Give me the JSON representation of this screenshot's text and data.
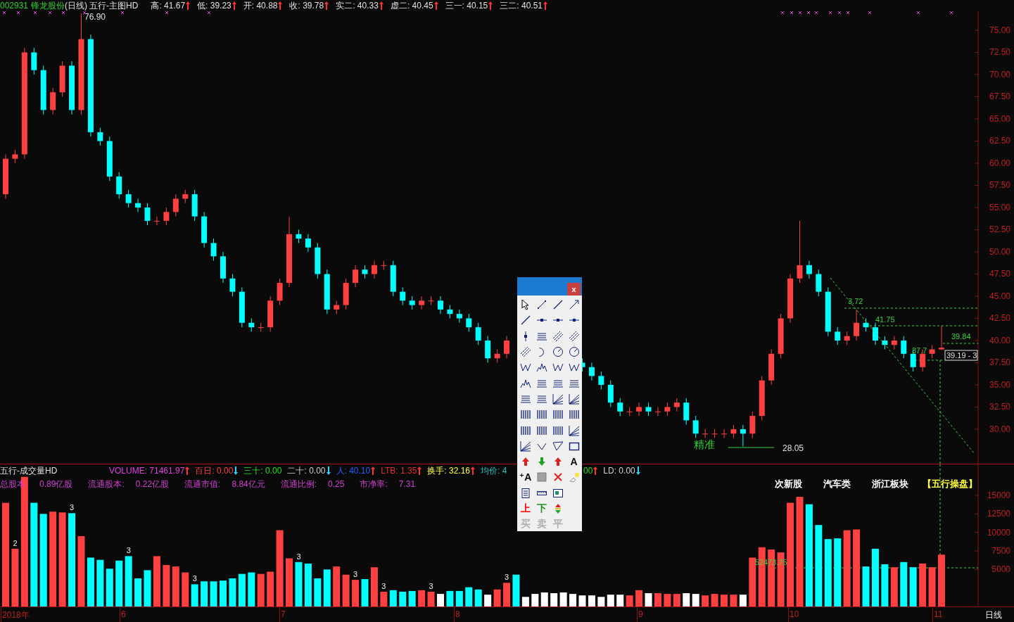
{
  "header": {
    "code": "002931",
    "name": "锋龙股份",
    "period": "(日线)",
    "indicator": "五行-主图HD",
    "quotes": [
      {
        "text": "高: 41.67",
        "arrow_up": true
      },
      {
        "text": "低: 39.23",
        "arrow_up": true
      },
      {
        "text": "开: 40.88",
        "arrow_up": true
      },
      {
        "text": "收: 39.78",
        "arrow_up": true
      },
      {
        "text": "实二: 40.33",
        "arrow_up": true
      },
      {
        "text": "虚二: 40.45",
        "arrow_up": true
      },
      {
        "text": "三一: 40.15",
        "arrow_up": true
      },
      {
        "text": "三二: 40.51",
        "arrow_up": true
      }
    ]
  },
  "price_chart": {
    "chart_data": {
      "type": "candlestick",
      "ylim": [
        26.11,
        77.14
      ],
      "yticks": [
        {
          "value": 30,
          "label": "30.00"
        },
        {
          "value": 32.5,
          "label": "32.50"
        },
        {
          "value": 35,
          "label": "35.00"
        },
        {
          "value": 37.5,
          "label": "37.50"
        },
        {
          "value": 40,
          "label": "40.00"
        },
        {
          "value": 42.5,
          "label": "42.50"
        },
        {
          "value": 45,
          "label": "45.00"
        },
        {
          "value": 47.5,
          "label": "47.50"
        },
        {
          "value": 50,
          "label": "50.00"
        },
        {
          "value": 52.5,
          "label": "52.50"
        },
        {
          "value": 55,
          "label": "55.00"
        },
        {
          "value": 57.5,
          "label": "57.50"
        },
        {
          "value": 60,
          "label": "60.00"
        },
        {
          "value": 62.5,
          "label": "62.50"
        },
        {
          "value": 65,
          "label": "65.00"
        },
        {
          "value": 67.5,
          "label": "67.50"
        },
        {
          "value": 70,
          "label": "70.00"
        },
        {
          "value": 72.5,
          "label": "72.50"
        },
        {
          "value": 75,
          "label": "75.00"
        }
      ],
      "categories": [
        null,
        null,
        null,
        null,
        null,
        null,
        null,
        null,
        null,
        null,
        null,
        null,
        null,
        null,
        null,
        null,
        null,
        null,
        null,
        null,
        null,
        null,
        null,
        null,
        null,
        null,
        null,
        null,
        null,
        null,
        null,
        null,
        null,
        null,
        null,
        null,
        null,
        null,
        null,
        null,
        null,
        null,
        null,
        null,
        null,
        null,
        null,
        null,
        null,
        null,
        null,
        null,
        null,
        null,
        null,
        null,
        null,
        null,
        null,
        null,
        null,
        null,
        null,
        null,
        null,
        null,
        null,
        null,
        null,
        null,
        null,
        null,
        null,
        null,
        null,
        null,
        null,
        null,
        null,
        null,
        null,
        null,
        null,
        null,
        null,
        null,
        null,
        null,
        null,
        null,
        null,
        null,
        null,
        null,
        null,
        null,
        null,
        null,
        null,
        null
      ],
      "ohlc": [
        [
          56.5,
          61,
          56,
          60.5
        ],
        [
          60.5,
          61.5,
          60,
          61
        ],
        [
          61,
          73,
          60.5,
          72.5
        ],
        [
          72.5,
          73,
          70,
          70.5
        ],
        [
          70.5,
          71,
          65.5,
          66
        ],
        [
          66,
          68.5,
          65.5,
          68
        ],
        [
          68,
          71.5,
          67.5,
          71
        ],
        [
          71,
          71.5,
          65.5,
          66
        ],
        [
          66,
          76.9,
          65.5,
          74
        ],
        [
          74,
          74.5,
          63,
          63.5
        ],
        [
          63.5,
          64,
          62,
          62.5
        ],
        [
          62.5,
          63,
          58,
          58.5
        ],
        [
          58.5,
          59,
          56,
          56.5
        ],
        [
          56.5,
          57,
          55,
          55.5
        ],
        [
          55.5,
          56,
          54.5,
          55
        ],
        [
          55,
          55.5,
          53,
          53.5
        ],
        [
          53.5,
          54,
          53,
          53.5
        ],
        [
          53.5,
          55,
          53,
          54.5
        ],
        [
          54.5,
          56.5,
          54,
          56
        ],
        [
          56,
          57,
          55.5,
          56.5
        ],
        [
          56.5,
          57,
          53.5,
          54
        ],
        [
          54,
          54.5,
          50.5,
          51
        ],
        [
          51,
          51.5,
          49,
          49.5
        ],
        [
          49.5,
          50,
          46.5,
          47
        ],
        [
          47,
          47.5,
          45,
          45.5
        ],
        [
          45.5,
          46,
          41.5,
          42
        ],
        [
          42,
          42.5,
          41,
          41.5
        ],
        [
          41.5,
          42,
          41,
          41.5
        ],
        [
          41.5,
          45,
          41,
          44.5
        ],
        [
          44.5,
          47,
          44,
          46.5
        ],
        [
          46.5,
          54,
          46,
          52
        ],
        [
          52,
          52.5,
          51,
          51.5
        ],
        [
          51.5,
          52,
          50,
          50.5
        ],
        [
          50.5,
          51,
          47,
          47.5
        ],
        [
          47.5,
          48,
          43,
          43.5
        ],
        [
          43.5,
          44.5,
          43,
          44
        ],
        [
          44,
          47,
          43.5,
          46.5
        ],
        [
          46.5,
          48.5,
          46,
          48
        ],
        [
          48,
          48.5,
          47,
          47.5
        ],
        [
          47.5,
          49,
          47,
          48.5
        ],
        [
          48.5,
          49,
          48,
          48.5
        ],
        [
          48.5,
          49,
          45,
          45.5
        ],
        [
          45.5,
          46,
          44,
          44.5
        ],
        [
          44.5,
          45,
          43.5,
          44
        ],
        [
          44,
          45,
          43.5,
          44.5
        ],
        [
          44.5,
          45,
          44,
          44.5
        ],
        [
          44.5,
          45,
          43,
          43.5
        ],
        [
          43.5,
          44,
          42.5,
          43
        ],
        [
          43,
          43.5,
          42,
          42.5
        ],
        [
          42.5,
          43,
          41,
          41.5
        ],
        [
          41.5,
          42,
          39.5,
          40
        ],
        [
          40,
          40.5,
          37.5,
          38
        ],
        [
          38,
          39,
          37.5,
          38.5
        ],
        [
          38.5,
          40.5,
          38,
          40
        ],
        null,
        null,
        null,
        null,
        null,
        null,
        null,
        [
          37.5,
          38,
          36.5,
          37
        ],
        [
          37,
          37.5,
          35.5,
          36
        ],
        [
          36,
          36.5,
          34.5,
          35
        ],
        [
          35,
          35.5,
          32.5,
          33
        ],
        [
          33,
          33.5,
          31.5,
          32
        ],
        [
          32,
          32.5,
          31.5,
          32
        ],
        [
          32,
          33,
          31.5,
          32.5
        ],
        [
          32.5,
          33,
          31.5,
          32
        ],
        [
          32,
          32.5,
          31.5,
          32
        ],
        [
          32,
          33,
          31.5,
          32.5
        ],
        [
          32.5,
          33.5,
          32,
          33
        ],
        [
          33,
          33.5,
          30.5,
          31
        ],
        [
          31,
          31.5,
          29,
          29.5
        ],
        [
          29.5,
          30,
          29,
          29.5
        ],
        [
          29.5,
          30,
          29,
          29.5
        ],
        [
          29.5,
          30,
          29,
          29.5
        ],
        [
          29.5,
          30.5,
          29,
          30
        ],
        [
          30,
          30.5,
          28.05,
          29.5
        ],
        [
          29.5,
          32,
          29,
          31.5
        ],
        [
          31.5,
          36,
          31,
          35.5
        ],
        [
          35.5,
          39,
          35,
          38.5
        ],
        [
          38.5,
          43,
          38,
          42.5
        ],
        [
          42.5,
          47.5,
          42,
          47
        ],
        [
          47,
          53.5,
          46.5,
          48.5
        ],
        [
          48.5,
          49,
          47,
          47.5
        ],
        [
          47.5,
          48,
          45,
          45.5
        ],
        [
          45.5,
          46,
          40.5,
          41
        ],
        [
          41,
          41.5,
          39.5,
          40
        ],
        [
          40,
          41,
          39.5,
          40.5
        ],
        [
          40.5,
          43.5,
          40,
          42
        ],
        [
          42,
          42.5,
          41,
          41.5
        ],
        [
          41.5,
          42,
          39.5,
          40
        ],
        [
          40,
          40.5,
          39,
          39.5
        ],
        [
          39.5,
          40.5,
          39,
          40
        ],
        [
          40,
          40.5,
          38,
          38.5
        ],
        [
          38.5,
          39,
          36.5,
          37
        ],
        [
          37,
          39,
          36.5,
          38.5
        ],
        [
          38.5,
          39.5,
          38,
          39
        ],
        [
          39,
          41.67,
          39,
          39.19
        ]
      ],
      "annotations": [
        "76.90",
        "28.05",
        "精准",
        "3.72",
        "41.75",
        "39.84",
        "37.7",
        "39.19 - 3"
      ]
    }
  },
  "volume_header": {
    "title": "五行-成交量HD",
    "items": [
      {
        "text": "VOLUME: 71461.97",
        "color": "#e040e0",
        "arrow_up": true,
        "arrow_down": false
      },
      {
        "text": "百日: 0.00",
        "color": "#ff4040",
        "arrow_up": false,
        "arrow_down": true
      },
      {
        "text": "三十: 0.00",
        "color": "#20e020",
        "arrow_up": false,
        "arrow_down": false
      },
      {
        "text": "二十: 0.00",
        "color": "#d0d0d0",
        "arrow_up": false,
        "arrow_down": true
      },
      {
        "text": "人: 40.10",
        "color": "#2060ff",
        "arrow_up": true,
        "arrow_down": false
      },
      {
        "text": "LTB: 1.35",
        "color": "#e03030",
        "arrow_up": true,
        "arrow_down": false
      },
      {
        "text": "换手: 32.16",
        "color": "#ffff40",
        "arrow_up": true,
        "arrow_down": false
      },
      {
        "text": "均价: 4",
        "color": "#20c0c0",
        "arrow_up": false,
        "arrow_down": false
      }
    ],
    "items_after_palette": [
      {
        "text": "00",
        "color": "#20e020",
        "arrow_up": true,
        "arrow_down": false
      },
      {
        "text": "LD: 0.00",
        "color": "#d0d0d0",
        "arrow_up": false,
        "arrow_down": true
      }
    ],
    "stats": [
      {
        "label": "总股本",
        "value": "0.89亿股"
      },
      {
        "label": "流通股本:",
        "value": "0.22亿股"
      },
      {
        "label": "流通市值:",
        "value": "8.84亿元"
      },
      {
        "label": "流通比例:",
        "value": "0.25"
      },
      {
        "label": "市净率:",
        "value": "7.31"
      }
    ],
    "tags": [
      {
        "text": "次新股",
        "color": "#ffffff"
      },
      {
        "text": "汽车类",
        "color": "#ffffff"
      },
      {
        "text": "浙江板块",
        "color": "#ffffff"
      },
      {
        "text": "【五行操盘】",
        "color": "#ffff40"
      }
    ]
  },
  "volume_chart": {
    "chart_data": {
      "type": "bar",
      "ylim": [
        0,
        19183
      ],
      "yticks": [
        5000,
        7500,
        10000,
        12500,
        15000
      ],
      "categories": [
        null,
        null,
        null,
        null,
        null,
        null,
        null,
        null,
        null,
        null,
        null,
        null,
        null,
        null,
        null,
        null,
        null,
        null,
        null,
        null,
        null,
        null,
        null,
        null,
        null,
        null,
        null,
        null,
        null,
        null,
        null,
        null,
        null,
        null,
        null,
        null,
        null,
        null,
        null,
        null,
        null,
        null,
        null,
        null,
        null,
        null,
        null,
        null,
        null,
        null,
        null,
        null,
        null,
        null,
        null,
        null,
        null,
        null,
        null,
        null,
        null,
        null,
        null,
        null,
        null,
        null,
        null,
        null,
        null,
        null,
        null,
        null,
        null,
        null,
        null,
        null,
        null,
        null,
        null,
        null,
        null,
        null,
        null,
        null,
        null,
        null,
        null,
        null,
        null,
        null,
        null,
        null,
        null,
        null,
        null,
        null,
        null,
        null,
        null,
        null
      ],
      "values": [
        14000,
        7800,
        17500,
        14000,
        12500,
        12800,
        12700,
        12600,
        9500,
        6600,
        6300,
        5100,
        6200,
        6800,
        3800,
        4900,
        6800,
        5600,
        5400,
        4600,
        3000,
        3400,
        3400,
        3500,
        3800,
        4400,
        4600,
        4400,
        4700,
        10300,
        6500,
        6000,
        5800,
        3800,
        5000,
        5400,
        4300,
        3600,
        3700,
        5300,
        2000,
        2200,
        2000,
        2100,
        2200,
        2000,
        1700,
        2100,
        2100,
        2600,
        2300,
        1600,
        2300,
        3200,
        4300,
        1300,
        1700,
        1900,
        1800,
        1900,
        1700,
        1500,
        1500,
        1300,
        1600,
        1600,
        1500,
        2200,
        1800,
        1800,
        1700,
        1700,
        1800,
        1700,
        1500,
        1700,
        1600,
        1600,
        1600,
        6600,
        8000,
        7700,
        7300,
        14000,
        14800,
        13800,
        11000,
        9100,
        9200,
        10300,
        10400,
        5400,
        7800,
        5700,
        5300,
        6000,
        5300,
        5800,
        5300,
        7000
      ],
      "annotations": [
        "2",
        "3",
        "3",
        "3",
        "3",
        "3",
        "3",
        "3",
        "3",
        "52473.75"
      ]
    }
  },
  "date_axis": {
    "labels": [
      "2018年",
      "6",
      "7",
      "8",
      "9",
      "10",
      "11"
    ],
    "period": "日线"
  },
  "draw_palette": {
    "tools": [
      {
        "kind": "cursor"
      },
      {
        "kind": "segment"
      },
      {
        "kind": "line"
      },
      {
        "kind": "arrow"
      },
      {
        "kind": "line"
      },
      {
        "kind": "dot-segment"
      },
      {
        "kind": "dot-segment"
      },
      {
        "kind": "dot-segment"
      },
      {
        "kind": "v-tick"
      },
      {
        "kind": "lines"
      },
      {
        "kind": "parallel"
      },
      {
        "kind": "parallel"
      },
      {
        "kind": "parallel"
      },
      {
        "kind": "arc"
      },
      {
        "kind": "circle"
      },
      {
        "kind": "circle"
      },
      {
        "kind": "wave"
      },
      {
        "kind": "peaks"
      },
      {
        "kind": "wave"
      },
      {
        "kind": "wave"
      },
      {
        "kind": "peaks"
      },
      {
        "kind": "lines"
      },
      {
        "kind": "lines"
      },
      {
        "kind": "lines"
      },
      {
        "kind": "lines"
      },
      {
        "kind": "lines"
      },
      {
        "kind": "fan"
      },
      {
        "kind": "fan"
      },
      {
        "kind": "bars"
      },
      {
        "kind": "bars"
      },
      {
        "kind": "bars"
      },
      {
        "kind": "bars"
      },
      {
        "kind": "bars"
      },
      {
        "kind": "bars"
      },
      {
        "kind": "bars"
      },
      {
        "kind": "fan"
      },
      {
        "kind": "fan"
      },
      {
        "kind": "check"
      },
      {
        "kind": "triangle"
      },
      {
        "kind": "rect"
      },
      {
        "kind": "up-arrow"
      },
      {
        "kind": "down-arrow"
      },
      {
        "kind": "up-arrow"
      },
      {
        "kind": "char",
        "text": "A",
        "color": "#000000"
      },
      {
        "kind": "char",
        "text": "⁺A",
        "color": "#000000"
      },
      {
        "kind": "square"
      },
      {
        "kind": "cross"
      },
      {
        "kind": "eraser"
      },
      {
        "kind": "doc"
      },
      {
        "kind": "ruler"
      },
      {
        "kind": "screen"
      },
      {
        "kind": "blank"
      },
      {
        "kind": "char",
        "text": "上",
        "color": "#ff0000"
      },
      {
        "kind": "char",
        "text": "下",
        "color": "#209020"
      },
      {
        "kind": "updown"
      },
      {
        "kind": "blank"
      },
      {
        "kind": "char",
        "text": "买",
        "color": "#b0b0b0"
      },
      {
        "kind": "char",
        "text": "卖",
        "color": "#b0b0b0"
      },
      {
        "kind": "char",
        "text": "平",
        "color": "#b0b0b0"
      }
    ],
    "close_label": "x"
  }
}
